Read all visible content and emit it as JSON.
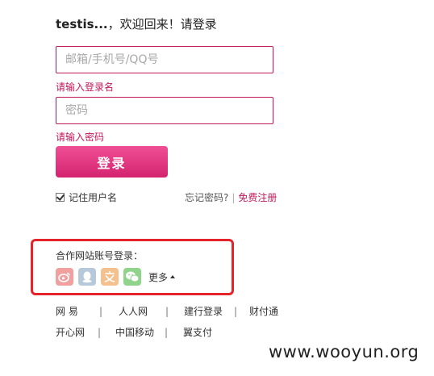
{
  "header": {
    "username": "testis...",
    "welcome": "，欢迎回来！请登录"
  },
  "login": {
    "account_placeholder": "邮箱/手机号/QQ号",
    "account_error": "请输入登录名",
    "password_placeholder": "密码",
    "password_error": "请输入密码",
    "submit_label": "登录",
    "remember_label": "记住用户名",
    "remember_checked": true,
    "forgot_label": "忘记密码?",
    "register_label": "免费注册"
  },
  "partners": {
    "title": "合作网站账号登录：",
    "icons": [
      "weibo-icon",
      "qq-icon",
      "alipay-icon",
      "wechat-icon"
    ],
    "more_label": "更多"
  },
  "footer": {
    "row1": [
      "网 易",
      "人人网",
      "建行登录",
      "财付通"
    ],
    "row2": [
      "开心网",
      "中国移动",
      "翼支付"
    ],
    "separator": "|"
  },
  "watermark": "www.wooyun.org",
  "colors": {
    "accent": "#c2185b",
    "button": "#e0337f",
    "highlight_box": "#e5232a"
  }
}
